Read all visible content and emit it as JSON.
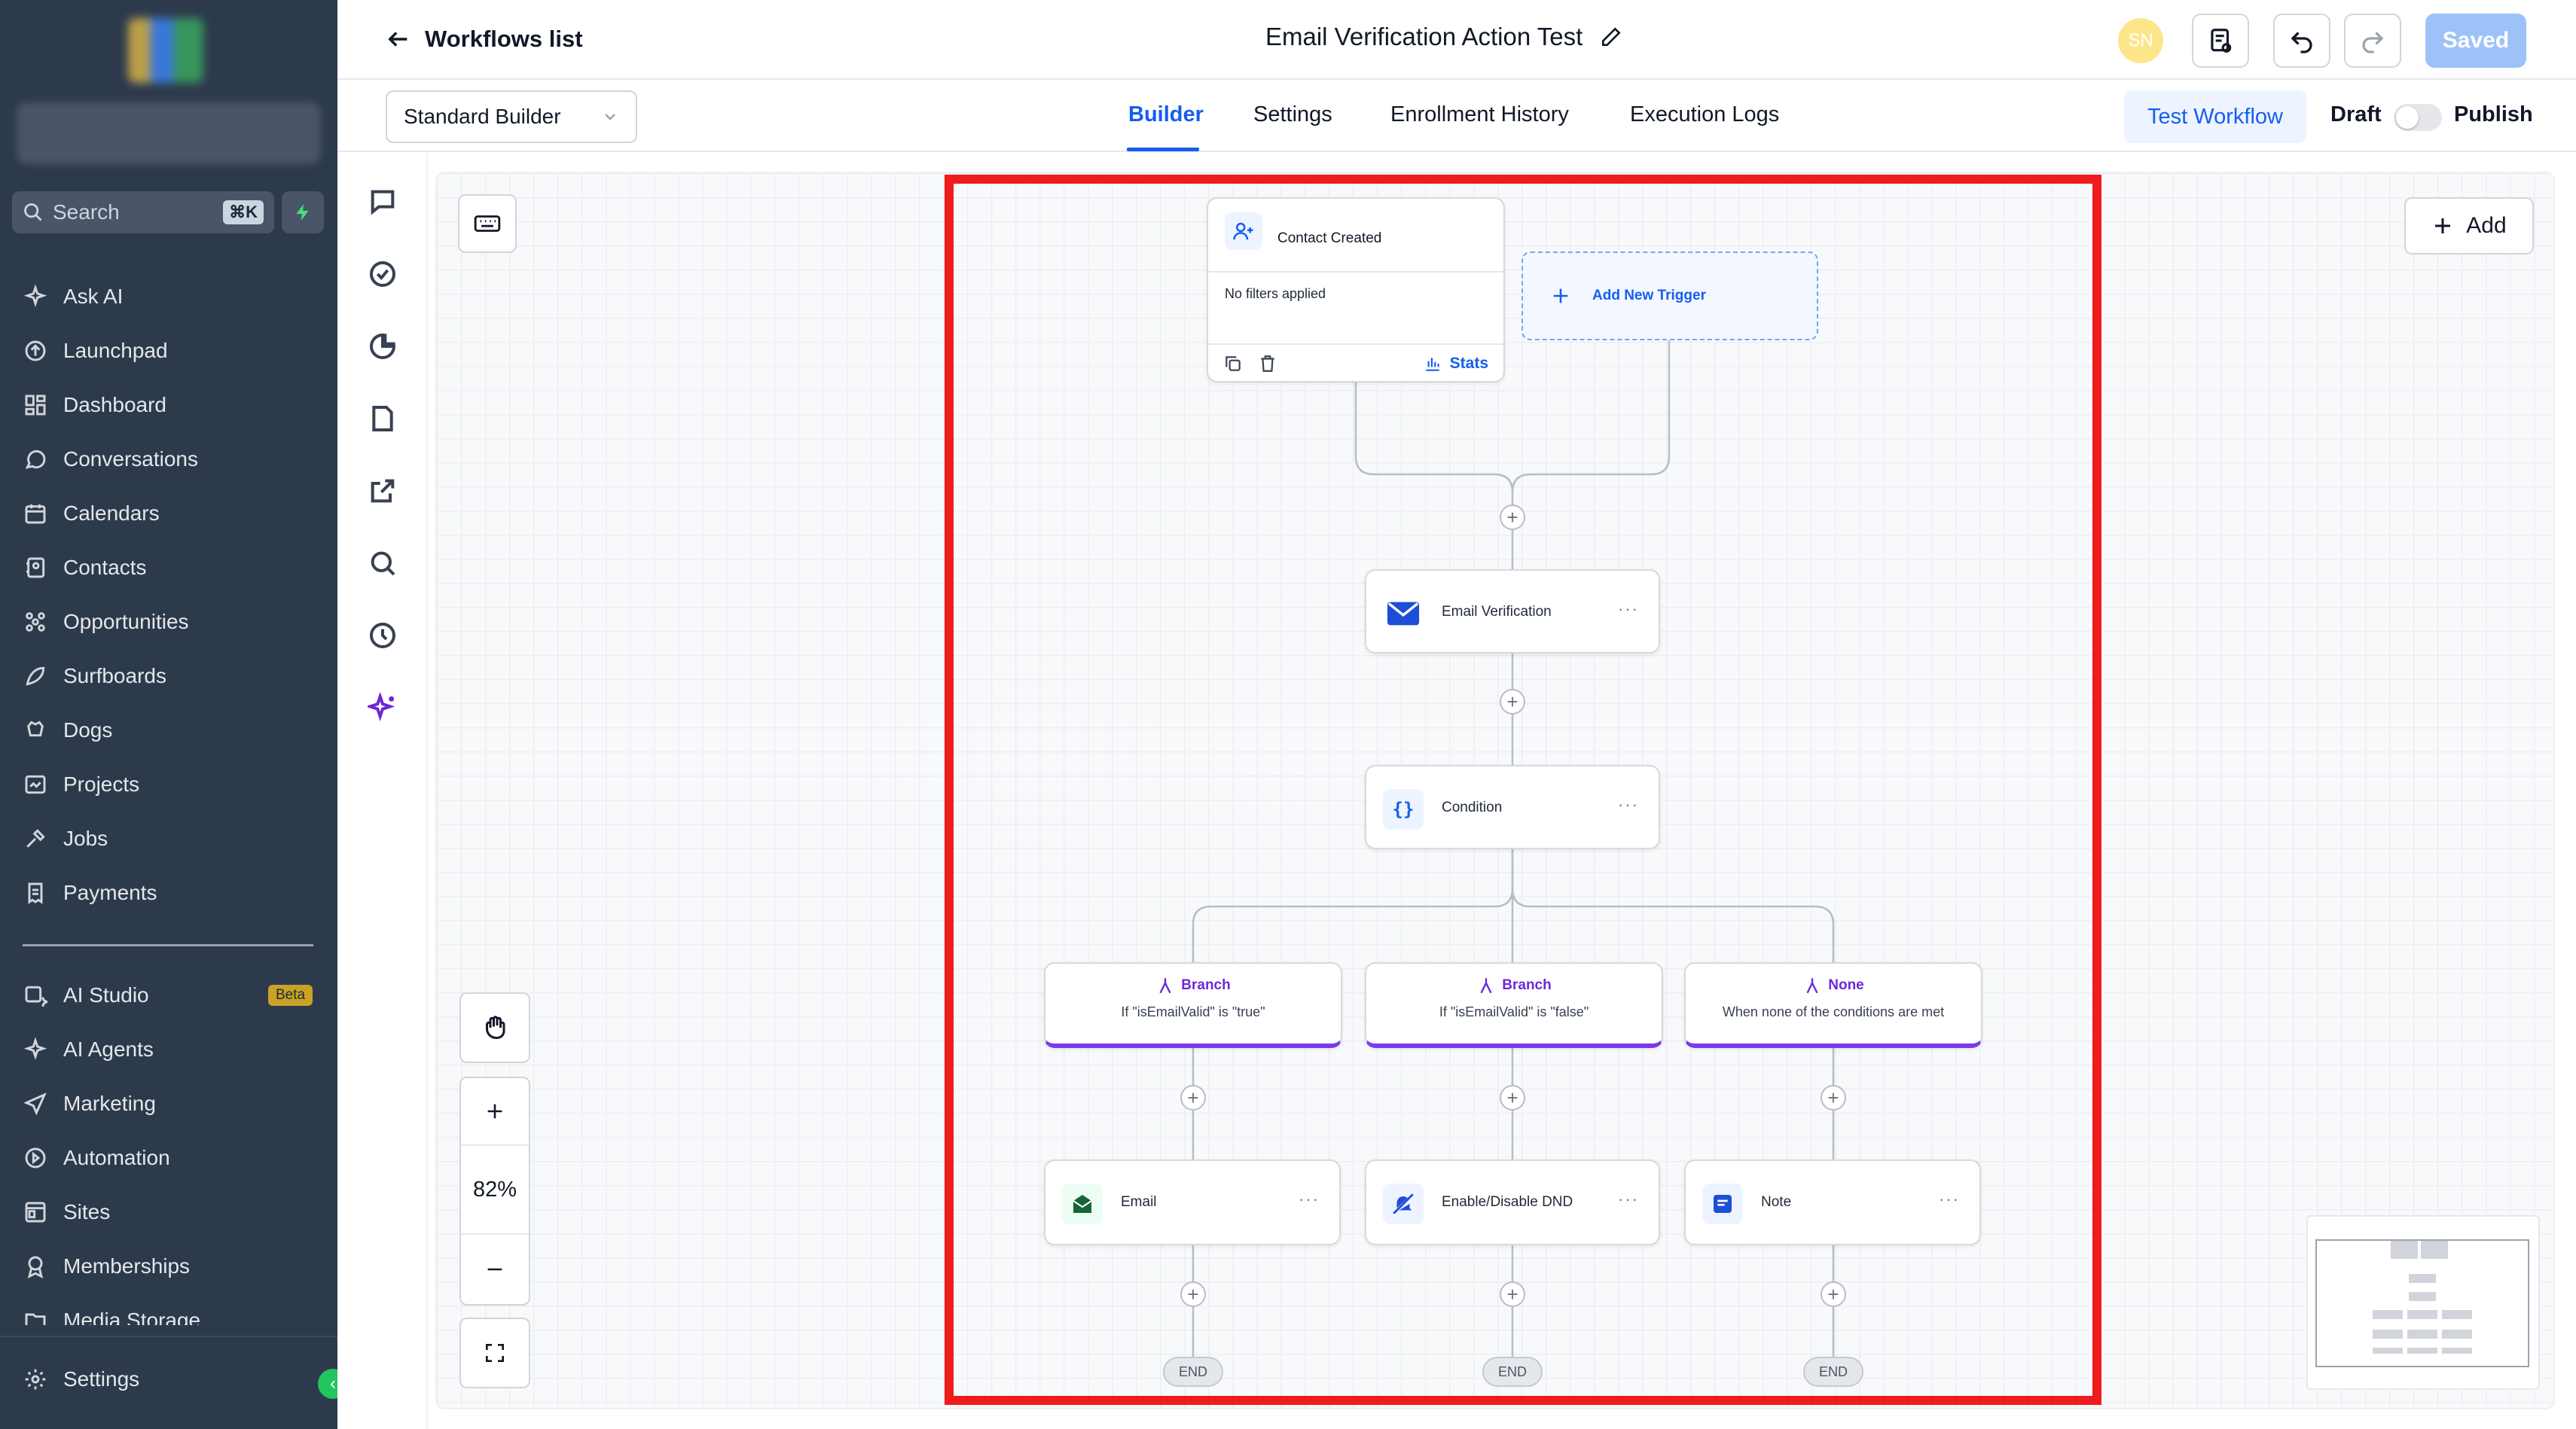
{
  "header": {
    "back_label": "Workflows list",
    "workflow_title": "Email Verification Action Test",
    "avatar_initials": "SN",
    "saved_label": "Saved"
  },
  "tabs": {
    "builder_select": "Standard Builder",
    "items": [
      "Builder",
      "Settings",
      "Enrollment History",
      "Execution Logs"
    ],
    "active": "Builder",
    "test_label": "Test Workflow",
    "draft_label": "Draft",
    "publish_label": "Publish"
  },
  "sidebar": {
    "search_placeholder": "Search",
    "search_shortcut": "⌘K",
    "items": [
      {
        "label": "Ask AI",
        "icon": "sparkle-icon"
      },
      {
        "label": "Launchpad",
        "icon": "rocket-icon"
      },
      {
        "label": "Dashboard",
        "icon": "grid-icon"
      },
      {
        "label": "Conversations",
        "icon": "chat-icon"
      },
      {
        "label": "Calendars",
        "icon": "calendar-icon"
      },
      {
        "label": "Contacts",
        "icon": "contacts-icon"
      },
      {
        "label": "Opportunities",
        "icon": "opportunities-icon"
      },
      {
        "label": "Surfboards",
        "icon": "surfboard-icon"
      },
      {
        "label": "Dogs",
        "icon": "dog-icon"
      },
      {
        "label": "Projects",
        "icon": "projects-icon"
      },
      {
        "label": "Jobs",
        "icon": "tools-icon"
      },
      {
        "label": "Payments",
        "icon": "receipt-icon"
      }
    ],
    "items2": [
      {
        "label": "AI Studio",
        "icon": "ai-studio-icon"
      },
      {
        "label": "AI Agents",
        "icon": "sparkle-icon"
      },
      {
        "label": "Marketing",
        "icon": "send-icon"
      },
      {
        "label": "Automation",
        "icon": "automation-icon"
      },
      {
        "label": "Sites",
        "icon": "sites-icon"
      },
      {
        "label": "Memberships",
        "icon": "membership-icon"
      },
      {
        "label": "Media Storage",
        "icon": "folder-icon"
      }
    ],
    "beta_badge": "Beta",
    "settings_label": "Settings"
  },
  "canvas": {
    "add_label": "Add",
    "zoom": "82%",
    "trigger": {
      "title": "Contact Created",
      "filters": "No filters applied",
      "stats_label": "Stats"
    },
    "add_trigger_label": "Add New Trigger",
    "nodes": {
      "email_verification": "Email Verification",
      "condition": "Condition",
      "email": "Email",
      "dnd": "Enable/Disable DND",
      "note": "Note"
    },
    "branches": [
      {
        "title": "Branch",
        "desc": "If \"isEmailValid\" is \"true\""
      },
      {
        "title": "Branch",
        "desc": "If \"isEmailValid\" is \"false\""
      },
      {
        "title": "None",
        "desc": "When none of the conditions are met"
      }
    ],
    "end_label": "END"
  },
  "colors": {
    "accent": "#155eef",
    "branch": "#7c3aed",
    "sidebar": "#2d3a4c",
    "highlight": "#ee1c1c"
  }
}
